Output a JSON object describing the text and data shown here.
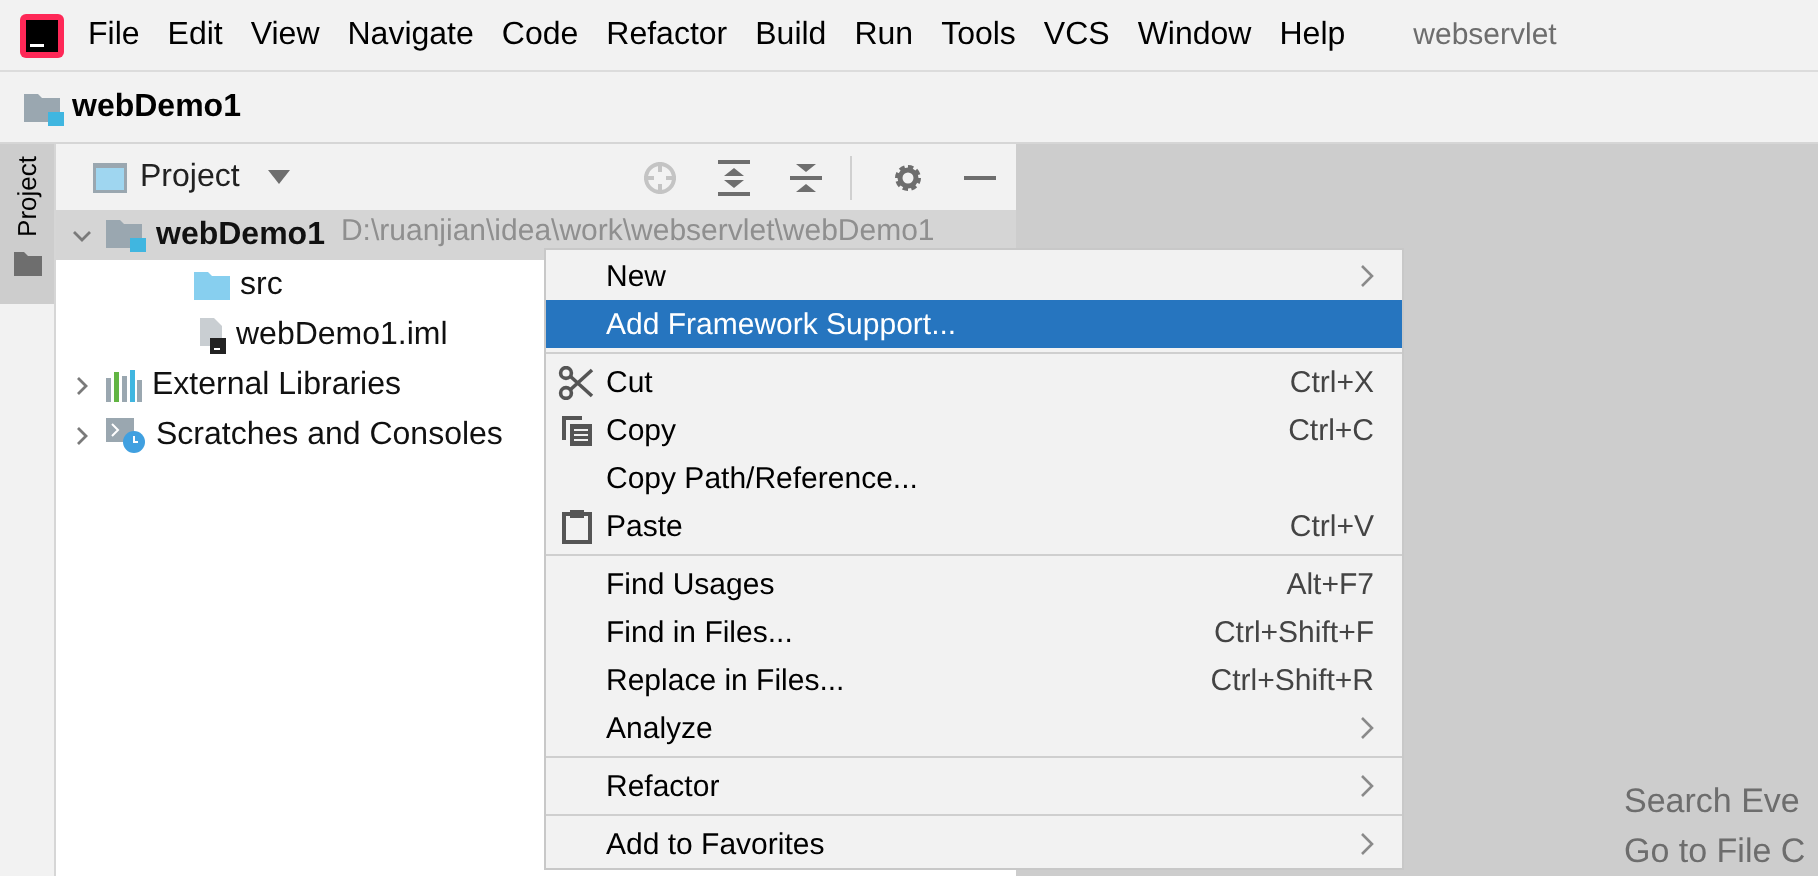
{
  "menu_bar": {
    "items": [
      "File",
      "Edit",
      "View",
      "Navigate",
      "Code",
      "Refactor",
      "Build",
      "Run",
      "Tools",
      "VCS",
      "Window",
      "Help"
    ],
    "title": "webservlet"
  },
  "navigation_bar": {
    "label": "webDemo1"
  },
  "tool_stripe": {
    "label": "Project"
  },
  "project_panel": {
    "title": "Project",
    "tree": [
      {
        "label": "webDemo1",
        "path": "D:\\ruanjian\\idea\\work\\webservlet\\webDemo1",
        "kind": "module",
        "expanded": true,
        "selected": true,
        "children": [
          {
            "label": "src",
            "kind": "folder",
            "selected": false
          },
          {
            "label": "webDemo1.iml",
            "kind": "file",
            "selected": false
          }
        ]
      },
      {
        "label": "External Libraries",
        "kind": "libraries",
        "expanded": false,
        "selected": false
      },
      {
        "label": "Scratches and Consoles",
        "kind": "scratches",
        "expanded": false,
        "selected": false
      }
    ]
  },
  "context_menu": [
    {
      "kind": "item",
      "label": "New",
      "submenu": true,
      "selected": false
    },
    {
      "kind": "item",
      "label": "Add Framework Support...",
      "submenu": false,
      "selected": true
    },
    {
      "kind": "separator"
    },
    {
      "kind": "cut",
      "label": "Cut",
      "shortcut": "Ctrl+X",
      "submenu": false,
      "selected": false
    },
    {
      "kind": "copy",
      "label": "Copy",
      "shortcut": "Ctrl+C",
      "submenu": false,
      "selected": false
    },
    {
      "kind": "item",
      "label": "Copy Path/Reference...",
      "submenu": false,
      "selected": false
    },
    {
      "kind": "paste",
      "label": "Paste",
      "shortcut": "Ctrl+V",
      "submenu": false,
      "selected": false
    },
    {
      "kind": "separator"
    },
    {
      "kind": "item",
      "label": "Find Usages",
      "shortcut": "Alt+F7",
      "submenu": false,
      "selected": false
    },
    {
      "kind": "item",
      "label": "Find in Files...",
      "shortcut": "Ctrl+Shift+F",
      "submenu": false,
      "selected": false
    },
    {
      "kind": "item",
      "label": "Replace in Files...",
      "shortcut": "Ctrl+Shift+R",
      "submenu": false,
      "selected": false
    },
    {
      "kind": "item",
      "label": "Analyze",
      "submenu": true,
      "selected": false
    },
    {
      "kind": "separator"
    },
    {
      "kind": "item",
      "label": "Refactor",
      "submenu": true,
      "selected": false
    },
    {
      "kind": "separator"
    },
    {
      "kind": "item",
      "label": "Add to Favorites",
      "submenu": true,
      "selected": false
    }
  ],
  "editor_hints": [
    "Search Eve",
    "Go to File C"
  ]
}
